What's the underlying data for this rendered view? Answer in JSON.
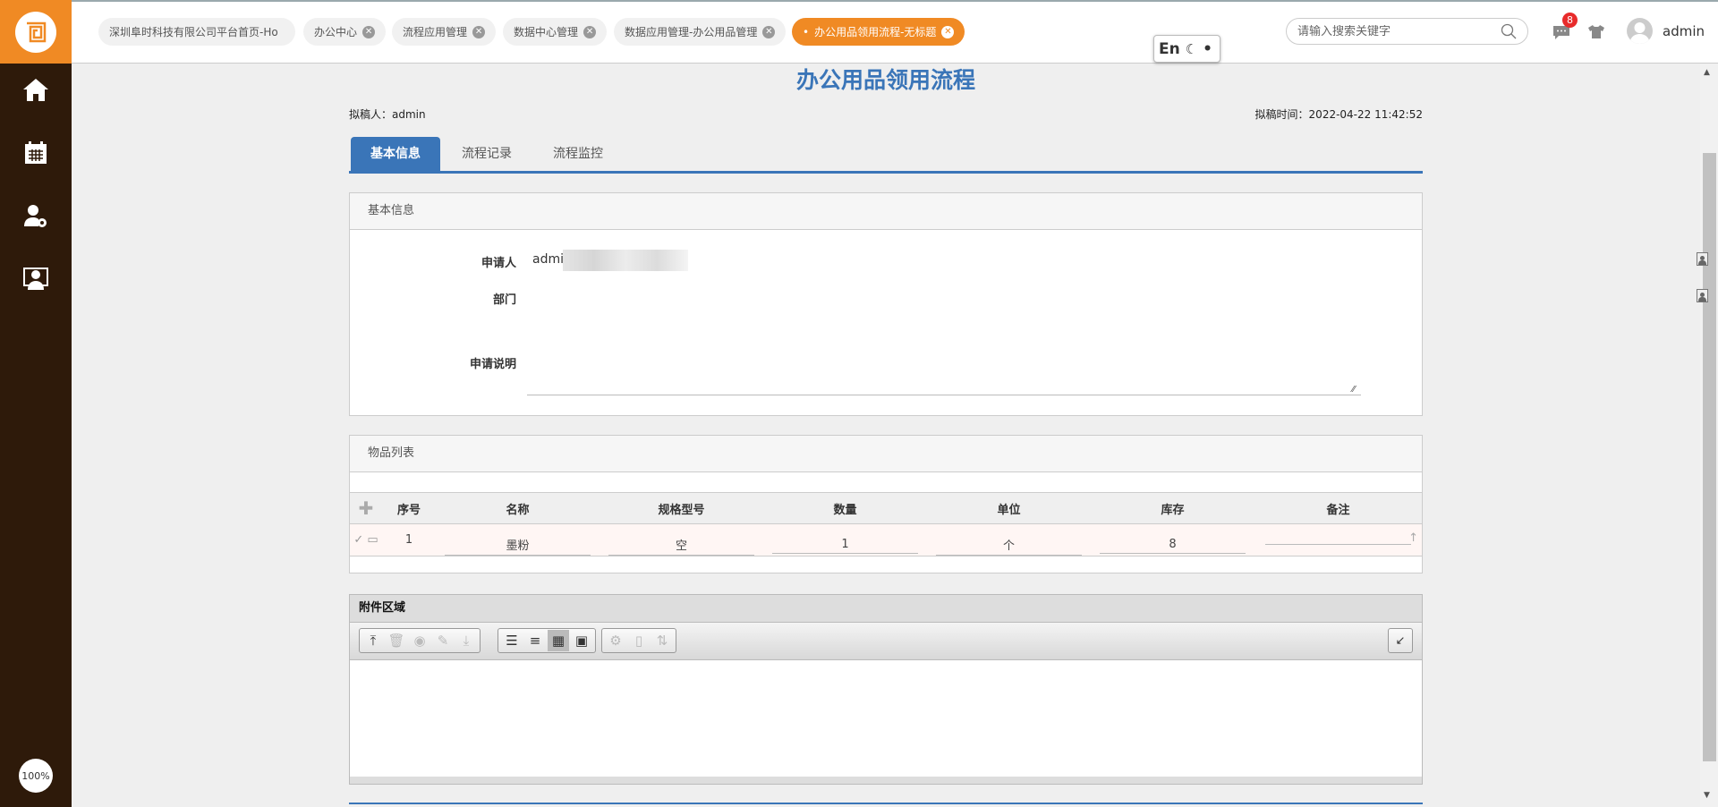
{
  "header": {
    "tabs": [
      {
        "label": "深圳阜时科技有限公司平台首页-Ho",
        "closable": false,
        "active": false
      },
      {
        "label": "办公中心",
        "closable": true,
        "active": false
      },
      {
        "label": "流程应用管理",
        "closable": true,
        "active": false
      },
      {
        "label": "数据中心管理",
        "closable": true,
        "active": false
      },
      {
        "label": "数据应用管理-办公用品管理",
        "closable": true,
        "active": false
      },
      {
        "label": "办公用品领用流程-无标题",
        "closable": true,
        "active": true
      }
    ],
    "ime": "En",
    "search_placeholder": "请输入搜索关键字",
    "message_count": "8",
    "username": "admin"
  },
  "sidebar": {
    "items": [
      "home",
      "calendar",
      "user-settings",
      "monitor-user"
    ],
    "zoom": "100%"
  },
  "form": {
    "title": "办公用品领用流程",
    "drafter": "拟稿人：admin",
    "draft_time": "拟稿时间：2022-04-22 11:42:52",
    "tabs": [
      "基本信息",
      "流程记录",
      "流程监控"
    ],
    "basic": {
      "header": "基本信息",
      "applicant_label": "申请人",
      "applicant_value": "admi",
      "dept_label": "部门",
      "dept_value": "",
      "desc_label": "申请说明",
      "desc_value": ""
    },
    "items": {
      "header": "物品列表",
      "columns": [
        "序号",
        "名称",
        "规格型号",
        "数量",
        "单位",
        "库存",
        "备注"
      ],
      "rows": [
        {
          "no": "1",
          "name": "墨粉",
          "spec": "空",
          "qty": "1",
          "unit": "个",
          "stock": "8",
          "remark": ""
        }
      ]
    },
    "attachments": {
      "header": "附件区域"
    }
  },
  "colors": {
    "brand": "#f08a24",
    "sidebar": "#2e1a0a",
    "accent": "#3a75b8"
  }
}
